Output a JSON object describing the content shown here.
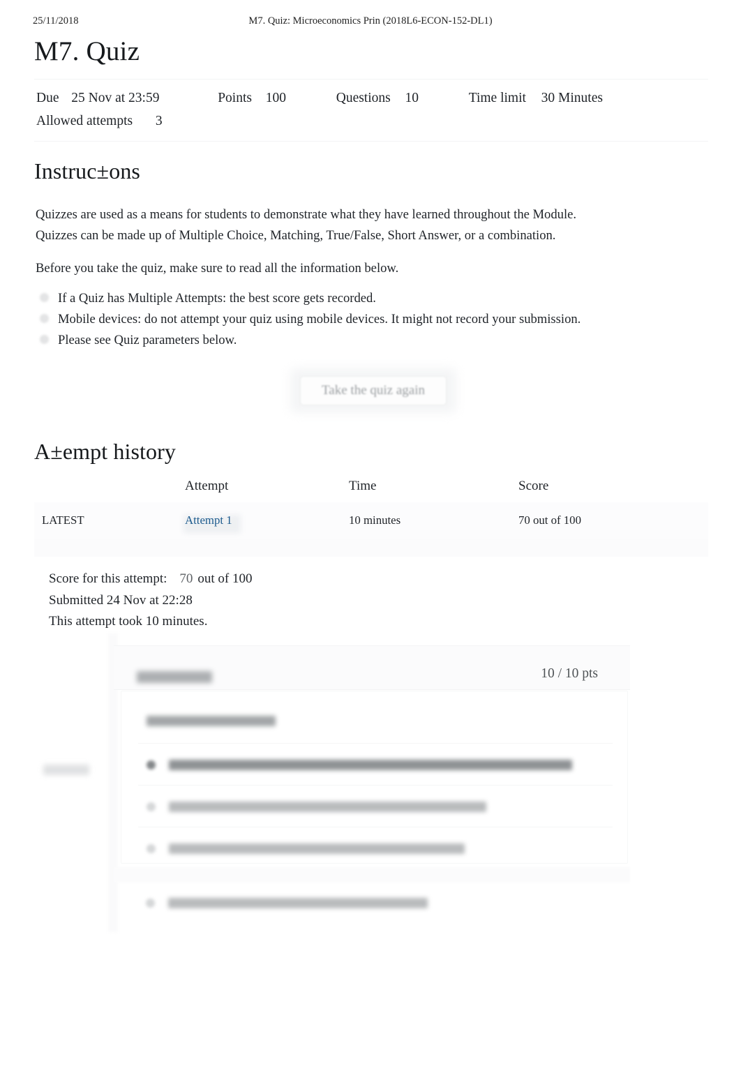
{
  "print_header": {
    "date": "25/11/2018",
    "document_title": "M7. Quiz: Microeconomics Prin (2018L6-ECON-152-DL1)"
  },
  "page_title": "M7. Quiz",
  "quiz_meta": {
    "due_label": "Due",
    "due_value": "25 Nov at 23:59",
    "points_label": "Points",
    "points_value": "100",
    "questions_label": "Questions",
    "questions_value": "10",
    "time_limit_label": "Time limit",
    "time_limit_value": "30 Minutes",
    "allowed_attempts_label": "Allowed attempts",
    "allowed_attempts_value": "3"
  },
  "instructions": {
    "heading": "Instruc±ons",
    "paragraph_1": "Quizzes are used as a means for students to demonstrate what they have learned throughout the Module.",
    "paragraph_2": "Quizzes can be made up of Multiple Choice, Matching, True/False, Short Answer, or a combination.",
    "paragraph_3": "Before you take the quiz, make sure to read all the information below.",
    "bullets": [
      "If a Quiz has Multiple Attempts: the best score gets recorded.",
      "Mobile devices: do not attempt your quiz using mobile devices. It might not record your submission.",
      "Please see Quiz parameters below."
    ]
  },
  "take_quiz_button": {
    "label": "Take the quiz again"
  },
  "attempt_history": {
    "heading": "A±empt history",
    "columns": [
      "",
      "Attempt",
      "Time",
      "Score"
    ],
    "rows": [
      {
        "kept": "LATEST",
        "attempt": "Attempt 1",
        "time": "10 minutes",
        "score": "70 out of 100"
      }
    ]
  },
  "attempt_summary": {
    "score_label": "Score for this attempt:",
    "score_value": "70",
    "score_suffix": "out of 100",
    "submitted": "Submitted 24 Nov at 22:28",
    "duration": "This attempt took 10 minutes."
  },
  "question": {
    "points": "10 / 10 pts",
    "question_label_redacted": "",
    "question_text_redacted": "",
    "answers_redacted": [
      "",
      "",
      "",
      ""
    ],
    "correct_flag_redacted": ""
  },
  "colors": {
    "link": "#1d5b8e",
    "text": "#1f2328",
    "muted": "#9a9ea1",
    "rule": "#f3f4f5"
  }
}
